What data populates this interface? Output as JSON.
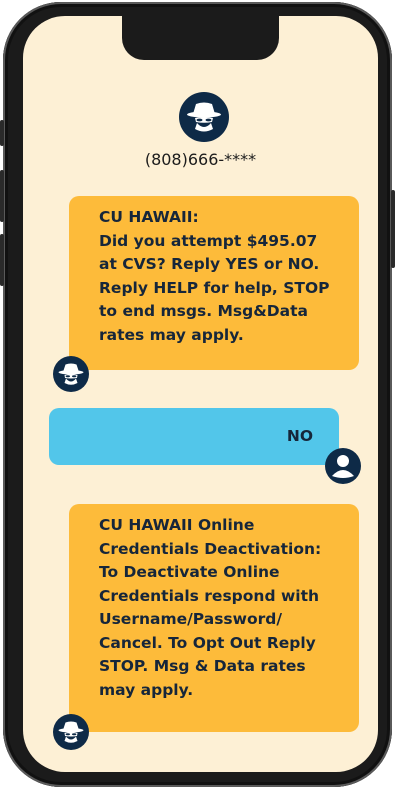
{
  "contact": {
    "phone": "(808)666-****",
    "avatar_icon": "hacker-icon"
  },
  "messages": [
    {
      "direction": "incoming",
      "lines": [
        "CU HAWAII:",
        "Did you attempt $495.07",
        "at CVS? Reply YES or NO.",
        "Reply HELP for help, STOP",
        "to end msgs. Msg&Data",
        "rates may apply."
      ],
      "avatar_icon": "hacker-icon"
    },
    {
      "direction": "outgoing",
      "lines": [
        "NO"
      ],
      "avatar_icon": "user-icon"
    },
    {
      "direction": "incoming",
      "lines": [
        "CU HAWAII Online",
        "Credentials Deactivation:",
        "To Deactivate Online",
        "Credentials respond with",
        "Username/Password/",
        "Cancel. To Opt Out Reply",
        "STOP. Msg & Data rates",
        "may apply."
      ],
      "avatar_icon": "hacker-icon"
    }
  ],
  "colors": {
    "screen_bg": "#fdf0d5",
    "incoming_bubble": "#fdbb3a",
    "outgoing_bubble": "#52c6ea",
    "avatar_bg": "#0e2a47",
    "text": "#16263a"
  }
}
